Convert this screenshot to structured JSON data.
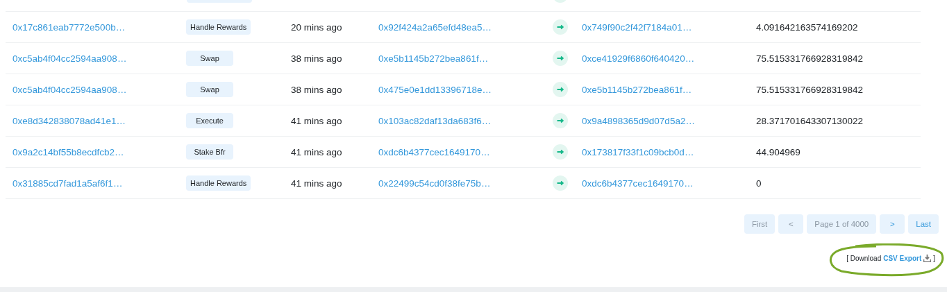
{
  "rows": [
    {
      "hash": "0x17c861eab7772e500b…",
      "method": "Handle Rewards",
      "age": "20 mins ago",
      "from": "0x92f424a2a65efd48ea5…",
      "to": "0x749f90c2f42f7184a01…",
      "value": "4.091642163574169202"
    },
    {
      "hash": "0xc5ab4f04cc2594aa908…",
      "method": "Swap",
      "age": "38 mins ago",
      "from": "0xe5b1145b272bea861f…",
      "to": "0xce41929f6860f640420…",
      "value": "75.515331766928319842"
    },
    {
      "hash": "0xc5ab4f04cc2594aa908…",
      "method": "Swap",
      "age": "38 mins ago",
      "from": "0x475e0e1dd13396718e…",
      "to": "0xe5b1145b272bea861f…",
      "value": "75.515331766928319842"
    },
    {
      "hash": "0xe8d342838078ad41e1…",
      "method": "Execute",
      "age": "41 mins ago",
      "from": "0x103ac82daf13da683f6…",
      "to": "0x9a4898365d9d07d5a2…",
      "value": "28.371701643307130022"
    },
    {
      "hash": "0x9a2c14bf55b8ecdfcb2…",
      "method": "Stake Bfr",
      "age": "41 mins ago",
      "from": "0xdc6b4377cec1649170…",
      "to": "0x173817f33f1c09bcb0d…",
      "value": "44.904969"
    },
    {
      "hash": "0x31885cd7fad1a5af6f1…",
      "method": "Handle Rewards",
      "age": "41 mins ago",
      "from": "0x22499c54cd0f38fe75b…",
      "to": "0xdc6b4377cec1649170…",
      "value": "0"
    }
  ],
  "pagination": [
    {
      "kind": "button",
      "label": "First",
      "disabled": true
    },
    {
      "kind": "button",
      "label": "<",
      "disabled": true
    },
    {
      "kind": "status",
      "label": "Page 1 of 4000",
      "disabled": true
    },
    {
      "kind": "button",
      "label": ">",
      "disabled": false
    },
    {
      "kind": "button",
      "label": "Last",
      "disabled": false
    }
  ],
  "download": {
    "open": "[ Download",
    "link": "CSV Export",
    "close": "]"
  }
}
